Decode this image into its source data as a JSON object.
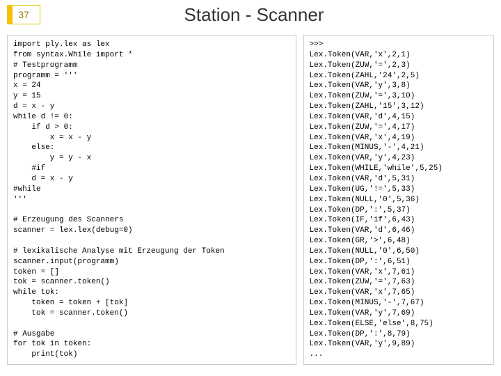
{
  "slide_number": "37",
  "title": "Station - Scanner",
  "left_code": "import ply.lex as lex\nfrom syntax.While import *\n# Testprogramm\nprogramm = '''\nx = 24\ny = 15\nd = x - y\nwhile d != 0:\n    if d > 0:\n        x = x - y\n    else:\n        y = y - x\n    #if\n    d = x - y\n#while\n'''\n\n# Erzeugung des Scanners\nscanner = lex.lex(debug=0)\n\n# lexikalische Analyse mit Erzeugung der Token\nscanner.input(programm)\ntoken = []\ntok = scanner.token()\nwhile tok:\n    token = token + [tok]\n    tok = scanner.token()\n\n# Ausgabe\nfor tok in token:\n    print(tok)",
  "right_output": ">>>\nLex.Token(VAR,'x',2,1)\nLex.Token(ZUW,'=',2,3)\nLex.Token(ZAHL,'24',2,5)\nLex.Token(VAR,'y',3,8)\nLex.Token(ZUW,'=',3,10)\nLex.Token(ZAHL,'15',3,12)\nLex.Token(VAR,'d',4,15)\nLex.Token(ZUW,'=',4,17)\nLex.Token(VAR,'x',4,19)\nLex.Token(MINUS,'-',4,21)\nLex.Token(VAR,'y',4,23)\nLex.Token(WHILE,'while',5,25)\nLex.Token(VAR,'d',5,31)\nLex.Token(UG,'!=',5,33)\nLex.Token(NULL,'0',5,36)\nLex.Token(DP,':',5,37)\nLex.Token(IF,'if',6,43)\nLex.Token(VAR,'d',6,46)\nLex.Token(GR,'>',6,48)\nLex.Token(NULL,'0',6,50)\nLex.Token(DP,':',6,51)\nLex.Token(VAR,'x',7,61)\nLex.Token(ZUW,'=',7,63)\nLex.Token(VAR,'x',7,65)\nLex.Token(MINUS,'-',7,67)\nLex.Token(VAR,'y',7,69)\nLex.Token(ELSE,'else',8,75)\nLex.Token(DP,':',8,79)\nLex.Token(VAR,'y',9,89)\n..."
}
